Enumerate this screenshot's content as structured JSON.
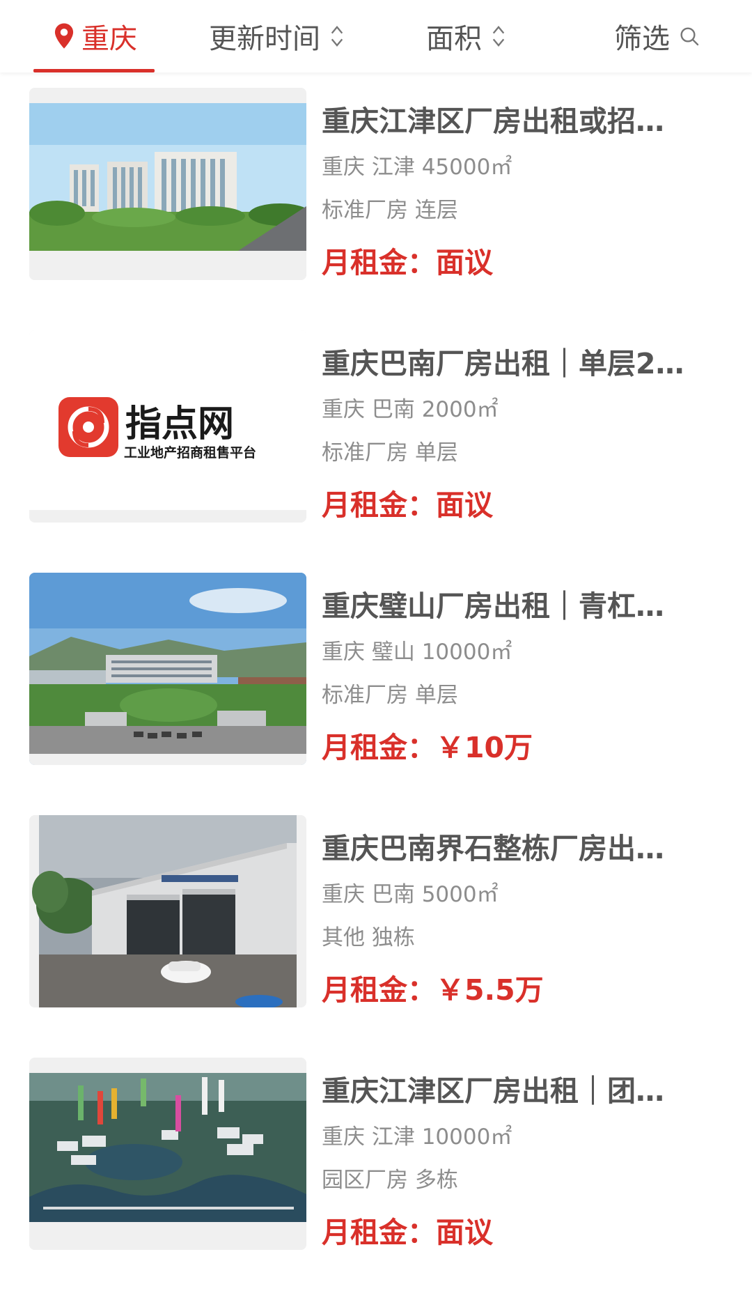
{
  "filter_bar": {
    "city": "重庆",
    "update_time_label": "更新时间",
    "area_label": "面积",
    "filter_label": "筛选"
  },
  "colors": {
    "accent": "#d9302a",
    "text": "#555555",
    "muted": "#8d8d8d"
  },
  "listings": [
    {
      "title": "重庆江津区厂房出租或招…",
      "location": "重庆 江津 45000㎡",
      "type": "标准厂房 连层",
      "rent_label": "月租金：",
      "rent_value": "面议",
      "image": "factory-buildings-photo"
    },
    {
      "title": "重庆巴南厂房出租｜单层2…",
      "location": "重庆 巴南 2000㎡",
      "type": "标准厂房 单层",
      "rent_label": "月租金：",
      "rent_value": "面议",
      "image": "zhidianwang-logo",
      "logo_title": "指点网",
      "logo_subtitle": "工业地产招商租售平台"
    },
    {
      "title": "重庆璧山厂房出租｜青杠…",
      "location": "重庆 璧山 10000㎡",
      "type": "标准厂房 单层",
      "rent_label": "月租金：",
      "rent_value": "￥10万",
      "image": "industrial-park-photo"
    },
    {
      "title": "重庆巴南界石整栋厂房出…",
      "location": "重庆 巴南 5000㎡",
      "type": "其他 独栋",
      "rent_label": "月租金：",
      "rent_value": "￥5.5万",
      "image": "warehouse-photo"
    },
    {
      "title": "重庆江津区厂房出租｜团…",
      "location": "重庆 江津 10000㎡",
      "type": "园区厂房 多栋",
      "rent_label": "月租金：",
      "rent_value": "面议",
      "image": "aerial-park-rendering"
    }
  ]
}
